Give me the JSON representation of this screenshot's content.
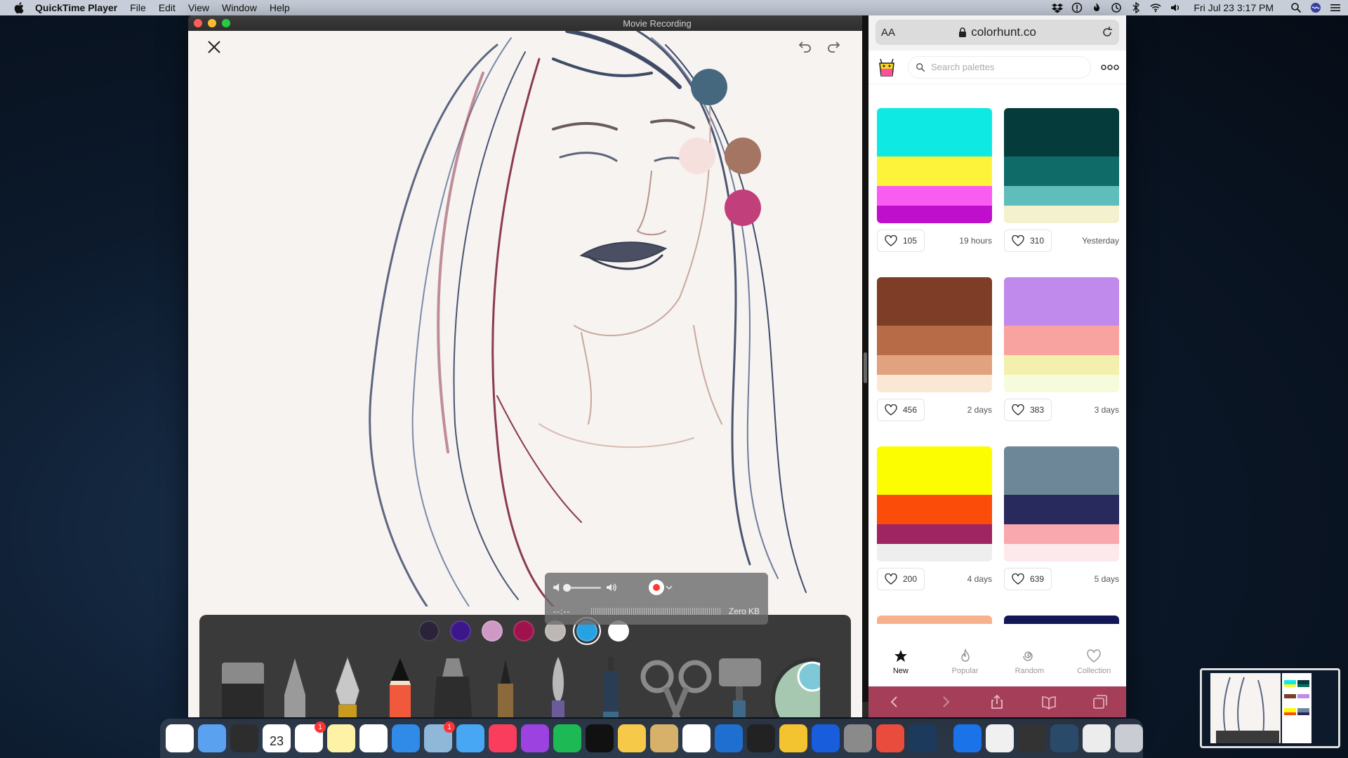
{
  "menubar": {
    "app_name": "QuickTime Player",
    "menus": [
      "File",
      "Edit",
      "View",
      "Window",
      "Help"
    ],
    "clock": "Fri Jul 23  3:17 PM",
    "status_icons": [
      "dropbox-icon",
      "info-icon",
      "flame-icon",
      "time-machine-icon",
      "bluetooth-icon",
      "wifi-icon",
      "volume-icon"
    ]
  },
  "window": {
    "title": "Movie Recording"
  },
  "drawing": {
    "side_colors": [
      "#46687f",
      "#f6e0de",
      "#a47563",
      "#c1407b"
    ],
    "palette_swatches": [
      "#2b2438",
      "#3c178a",
      "#cf99c6",
      "#a0124b",
      "#bdb8b5",
      "#26a2e3",
      "#ffffff"
    ],
    "selected_swatch": 5,
    "tools": [
      "eraser",
      "pencil-grey",
      "fountain-pen",
      "pencil-red",
      "marker",
      "brush-pen",
      "watercolor-brush",
      "fineliner",
      "scissors",
      "roller"
    ]
  },
  "recording_hud": {
    "time": "--:--",
    "size": "Zero KB",
    "record_color": "#ff3b30"
  },
  "safari": {
    "url": "colorhunt.co",
    "aa_label": "AA",
    "search_placeholder": "Search palettes",
    "palettes": [
      {
        "colors": [
          "#0fe9e3",
          "#fdf33a",
          "#f95cf1",
          "#c00ecd"
        ],
        "likes": "105",
        "age": "19 hours"
      },
      {
        "colors": [
          "#063b3b",
          "#0f6b67",
          "#5fbdbc",
          "#f4f1cf"
        ],
        "likes": "310",
        "age": "Yesterday"
      },
      {
        "colors": [
          "#7e3d26",
          "#b86b47",
          "#e0a27f",
          "#fbe8d4"
        ],
        "likes": "456",
        "age": "2 days"
      },
      {
        "colors": [
          "#c089ec",
          "#f9a3a1",
          "#f3f0ad",
          "#f6fbdc"
        ],
        "likes": "383",
        "age": "3 days"
      },
      {
        "colors": [
          "#fbfd00",
          "#fb4c0a",
          "#9e2462",
          "#eeeeee"
        ],
        "likes": "200",
        "age": "4 days"
      },
      {
        "colors": [
          "#6e8798",
          "#28295c",
          "#f9a8ad",
          "#fde9eb"
        ],
        "likes": "639",
        "age": "5 days"
      }
    ],
    "peek_colors": [
      "#f8b18d",
      "#131755"
    ],
    "tabs": [
      {
        "label": "New",
        "icon": "star-icon",
        "active": true
      },
      {
        "label": "Popular",
        "icon": "fire-icon",
        "active": false
      },
      {
        "label": "Random",
        "icon": "spiral-icon",
        "active": false
      },
      {
        "label": "Collection",
        "icon": "heart-icon",
        "active": false
      }
    ]
  },
  "dock": {
    "apps": [
      {
        "name": "chrome-app",
        "color": "#ffffff",
        "badge": ""
      },
      {
        "name": "finder-app",
        "color": "#5aa2ef",
        "badge": ""
      },
      {
        "name": "mission-control-app",
        "color": "#2d2d2d",
        "badge": ""
      },
      {
        "name": "calendar-app",
        "color": "#ffffff",
        "badge": "",
        "label": "23"
      },
      {
        "name": "reminders-app",
        "color": "#ffffff",
        "badge": "1"
      },
      {
        "name": "notes-app",
        "color": "#fdf2a6",
        "badge": ""
      },
      {
        "name": "chrome-app-2",
        "color": "#ffffff",
        "badge": ""
      },
      {
        "name": "safari-app",
        "color": "#2f8ae8",
        "badge": ""
      },
      {
        "name": "preview-app",
        "color": "#8fb7d8",
        "badge": "1"
      },
      {
        "name": "messages-app",
        "color": "#47a7f5",
        "badge": ""
      },
      {
        "name": "music-app",
        "color": "#fa3d5c",
        "badge": ""
      },
      {
        "name": "podcasts-app",
        "color": "#9b42e0",
        "badge": ""
      },
      {
        "name": "spotify-app",
        "color": "#1db954",
        "badge": ""
      },
      {
        "name": "tv-app",
        "color": "#111111",
        "badge": ""
      },
      {
        "name": "photos-app",
        "color": "#f7c948",
        "badge": ""
      },
      {
        "name": "pantheon-app",
        "color": "#d7b06a",
        "badge": ""
      },
      {
        "name": "vscode-app",
        "color": "#ffffff",
        "badge": ""
      },
      {
        "name": "maps-pin-app",
        "color": "#1f6fd1",
        "badge": ""
      },
      {
        "name": "terminal-app",
        "color": "#222222",
        "badge": ""
      },
      {
        "name": "cyberduck-app",
        "color": "#f4c430",
        "badge": ""
      },
      {
        "name": "bitwarden-app",
        "color": "#175ddc",
        "badge": ""
      },
      {
        "name": "system-preferences-app",
        "color": "#8a8a8a",
        "badge": ""
      },
      {
        "name": "affinity-app",
        "color": "#e94c3d",
        "badge": ""
      },
      {
        "name": "quicktime-app",
        "color": "#1c3b5c",
        "badge": ""
      }
    ],
    "right_apps": [
      {
        "name": "1password-app",
        "color": "#1a73e8"
      },
      {
        "name": "document-stack-app",
        "color": "#f0f0f0"
      },
      {
        "name": "screenshot-stack-app",
        "color": "#333333"
      },
      {
        "name": "screenshot-stack-app-2",
        "color": "#2a4a6a"
      },
      {
        "name": "downloads-stack-app",
        "color": "#ececec"
      },
      {
        "name": "trash-app",
        "color": "#c9cdd3"
      }
    ]
  }
}
